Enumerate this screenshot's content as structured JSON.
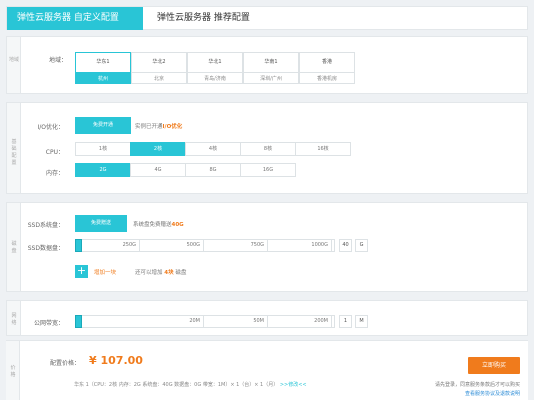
{
  "tabs": [
    "弹性云服务器 自定义配置",
    "弹性云服务器 推荐配置"
  ],
  "region_section": {
    "side": "地域",
    "label": "地域：",
    "regions": [
      {
        "title": "华东1",
        "sub": "杭州",
        "selected": true
      },
      {
        "title": "华北2",
        "sub": "北京",
        "selected": false
      },
      {
        "title": "华北1",
        "sub": "青岛/济南",
        "selected": false
      },
      {
        "title": "华南1",
        "sub": "深圳/广州",
        "selected": false
      },
      {
        "title": "香港",
        "sub": "香港机房",
        "selected": false
      }
    ]
  },
  "config_section": {
    "side": "基础配置",
    "io_label": "I/O优化：",
    "io_button": "免费开通",
    "io_note_prefix": "实例已开通",
    "io_note_strong": "I/O优化",
    "cpu_label": "CPU：",
    "cpu_options": [
      {
        "label": "1核",
        "selected": false
      },
      {
        "label": "2核",
        "selected": true
      },
      {
        "label": "4核",
        "selected": false
      },
      {
        "label": "8核",
        "selected": false
      },
      {
        "label": "16核",
        "selected": false
      }
    ],
    "mem_label": "内存：",
    "mem_options": [
      {
        "label": "2G",
        "selected": true
      },
      {
        "label": "4G",
        "selected": false
      },
      {
        "label": "8G",
        "selected": false
      },
      {
        "label": "16G",
        "selected": false
      }
    ]
  },
  "disk_section": {
    "side": "磁盘",
    "system_label": "SSD系统盘：",
    "system_button": "免费赠送",
    "system_note_prefix": "系统盘免费赠送",
    "system_note_strong": "40G",
    "data_label": "SSD数据盘：",
    "ticks": [
      "250G",
      "500G",
      "750G",
      "1000G"
    ],
    "value": "40",
    "unit": "G",
    "add_prefix": "增加一块",
    "add_note_prefix": "还可以增加",
    "add_note_strong": "4块",
    "add_note_suffix": "磁盘"
  },
  "network_section": {
    "side": "网络",
    "label": "公网带宽：",
    "ticks": [
      "20M",
      "50M",
      "200M"
    ],
    "value": "1",
    "unit": "M"
  },
  "price_section": {
    "side": "价格",
    "label": "配置价格：",
    "price": "¥ 107.00",
    "buy_button": "立即购买",
    "summary": "华东 1（CPU：2核 内存：2G 系统盘：40G 数据盘：0G 带宽：1M）× 1（台）× 1（月）",
    "summary_link": ">>修改<<",
    "agree_text": "请先登录，同意服务条款后才可以购买",
    "agree_link": "查看服务协议及退款说明"
  },
  "colors": {
    "accent": "#29c5d6",
    "price": "#f07b1c"
  }
}
